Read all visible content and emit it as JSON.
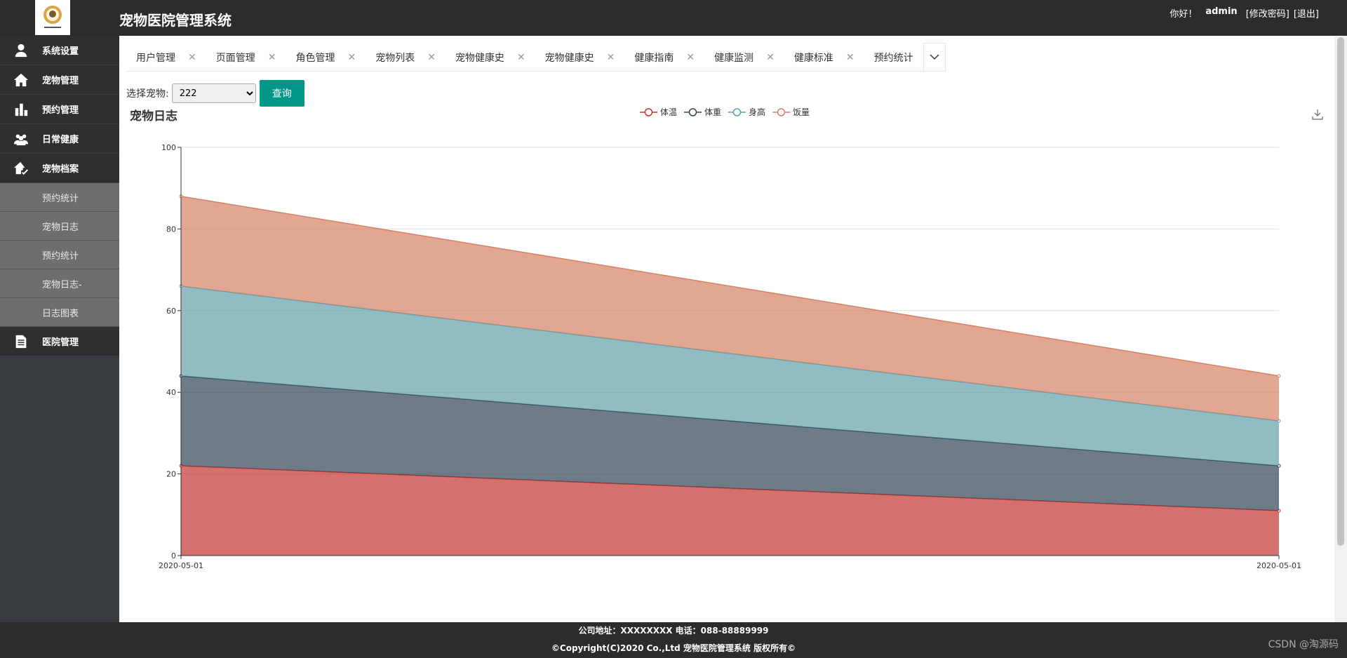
{
  "header": {
    "title": "宠物医院管理系统",
    "greeting": "你好！",
    "username": "admin",
    "change_password": "[修改密码]",
    "logout": "[退出]"
  },
  "sidebar": {
    "items": [
      {
        "label": "系统设置",
        "icon": "user-icon"
      },
      {
        "label": "宠物管理",
        "icon": "home-icon"
      },
      {
        "label": "预约管理",
        "icon": "bar-chart-icon"
      },
      {
        "label": "日常健康",
        "icon": "group-icon"
      },
      {
        "label": "宠物档案",
        "icon": "home-check-icon"
      }
    ],
    "sub_items": [
      "预约统计",
      "宠物日志",
      "预约统计",
      "宠物日志-",
      "日志图表"
    ],
    "last_item": {
      "label": "医院管理",
      "icon": "document-icon"
    }
  },
  "tabs": [
    "用户管理",
    "页面管理",
    "角色管理",
    "宠物列表",
    "宠物健康史",
    "宠物健康史",
    "健康指南",
    "健康监测",
    "健康标准",
    "预约统计"
  ],
  "filter": {
    "label": "选择宠物:",
    "selected": "222",
    "button": "查询"
  },
  "chart_data": {
    "type": "area",
    "stacked": true,
    "title": "宠物日志",
    "x": [
      "2020-05-01",
      "2020-05-01"
    ],
    "series": [
      {
        "name": "体温",
        "values": [
          22,
          11
        ],
        "color": "#c23531"
      },
      {
        "name": "体重",
        "values": [
          22,
          11
        ],
        "color": "#2f4554"
      },
      {
        "name": "身高",
        "values": [
          22,
          11
        ],
        "color": "#61a0a8"
      },
      {
        "name": "饭量",
        "values": [
          22,
          11
        ],
        "color": "#d48265"
      }
    ],
    "ylim": [
      0,
      100
    ],
    "yticks": [
      0,
      20,
      40,
      60,
      80,
      100
    ],
    "grid": true,
    "legend": "top-center"
  },
  "footer": {
    "line1": "公司地址：XXXXXXXX 电话：088-88889999",
    "line2": "©Copyright(C)2020 Co.,Ltd 宠物医院管理系统 版权所有©"
  },
  "watermark": "CSDN @淘源码"
}
